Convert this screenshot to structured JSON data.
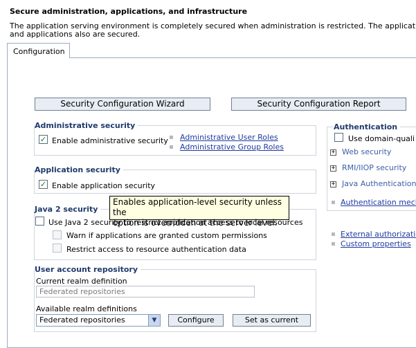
{
  "page": {
    "title": "Secure administration, applications, and infrastructure",
    "description_line1": "The application serving environment is completely secured when administration is restricted. The applicat",
    "description_line2": "and applications also are secured."
  },
  "tabs": [
    {
      "label": "Configuration"
    }
  ],
  "buttons": {
    "wizard": "Security Configuration Wizard",
    "report": "Security Configuration Report"
  },
  "admin_security": {
    "legend": "Administrative security",
    "enable_label": "Enable administrative security",
    "enabled": true,
    "links": [
      "Administrative User Roles",
      "Administrative Group Roles"
    ]
  },
  "app_security": {
    "legend": "Application security",
    "enable_label": "Enable application security",
    "enabled": true
  },
  "tooltip": {
    "line1": "Enables application-level security unless the",
    "line2": "option is overridden at the server level."
  },
  "java2": {
    "legend": "Java 2 security",
    "use_label": "Use Java 2 security to restrict application access to local resources",
    "warn_label": "Warn if applications are granted custom permissions",
    "restrict_label": "Restrict access to resource authentication data",
    "use_checked": false,
    "warn_checked": false,
    "restrict_checked": false
  },
  "user_repo": {
    "legend": "User account repository",
    "current_label": "Current realm definition",
    "current_value": "Federated repositories",
    "available_label": "Available realm definitions",
    "available_selected": "Federated repositories",
    "configure_button": "Configure",
    "set_current_button": "Set as current"
  },
  "authentication": {
    "legend": "Authentication",
    "use_domain_label": "Use domain-quali",
    "items": [
      "Web security",
      "RMI/IIOP security",
      "Java Authentication"
    ],
    "mechanisms_link": "Authentication mecha",
    "external_link": "External authorization",
    "custom_link": "Custom properties"
  },
  "colors": {
    "legend": "#1f3a6b",
    "link": "#1f3aa0",
    "tooltip_bg": "#ffffe1",
    "button_bg": "#e8edf4"
  },
  "icons": {
    "check": "checkmark-icon",
    "expand": "plus-expand-icon",
    "bullet": "square-bullet-icon",
    "dropdown": "chevron-down-icon"
  }
}
